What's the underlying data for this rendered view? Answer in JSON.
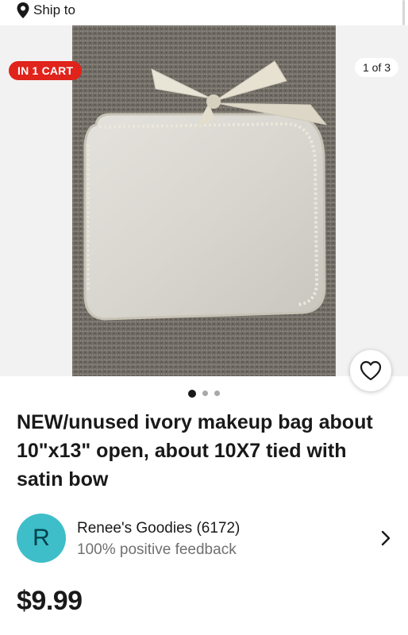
{
  "header": {
    "ship_to_label": "Ship to",
    "location_icon": "location-pin-icon"
  },
  "gallery": {
    "cart_badge": "IN 1 CART",
    "counter": "1 of 3",
    "image_count": 3,
    "active_image": 1,
    "watch_icon": "heart-icon"
  },
  "listing": {
    "title": "NEW/unused ivory makeup bag about 10\"x13\" open, about 10X7 tied with satin bow",
    "price": "$9.99"
  },
  "seller": {
    "avatar_letter": "R",
    "name": "Renee's Goodies (6172)",
    "feedback": "100% positive feedback",
    "chevron_icon": "chevron-right-icon"
  },
  "colors": {
    "badge_red": "#e0231b",
    "avatar_teal": "#3ebec9",
    "text_primary": "#191919",
    "text_secondary": "#707070"
  }
}
